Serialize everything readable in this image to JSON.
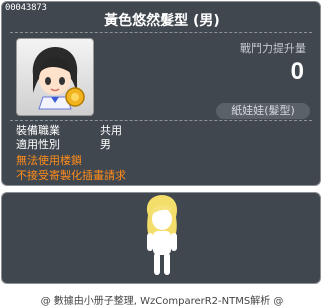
{
  "item": {
    "id": "00043873",
    "name": "黃色悠然髮型 (男)",
    "power_label": "戰鬥力提升量",
    "power_value": "0",
    "category": "紙娃娃(髮型)"
  },
  "details": [
    {
      "key": "裝備職業",
      "value": "共用"
    },
    {
      "key": "適用性別",
      "value": "男"
    }
  ],
  "warnings": [
    "無法使用楼鎖",
    "不接受寄製化插畫請求"
  ],
  "footer": "@ 數據由小册子整理, WzComparerR2-NTMS解析 @",
  "colors": {
    "panel": "#41474f",
    "warning": "#ff8c1a",
    "text": "#ffffff"
  }
}
